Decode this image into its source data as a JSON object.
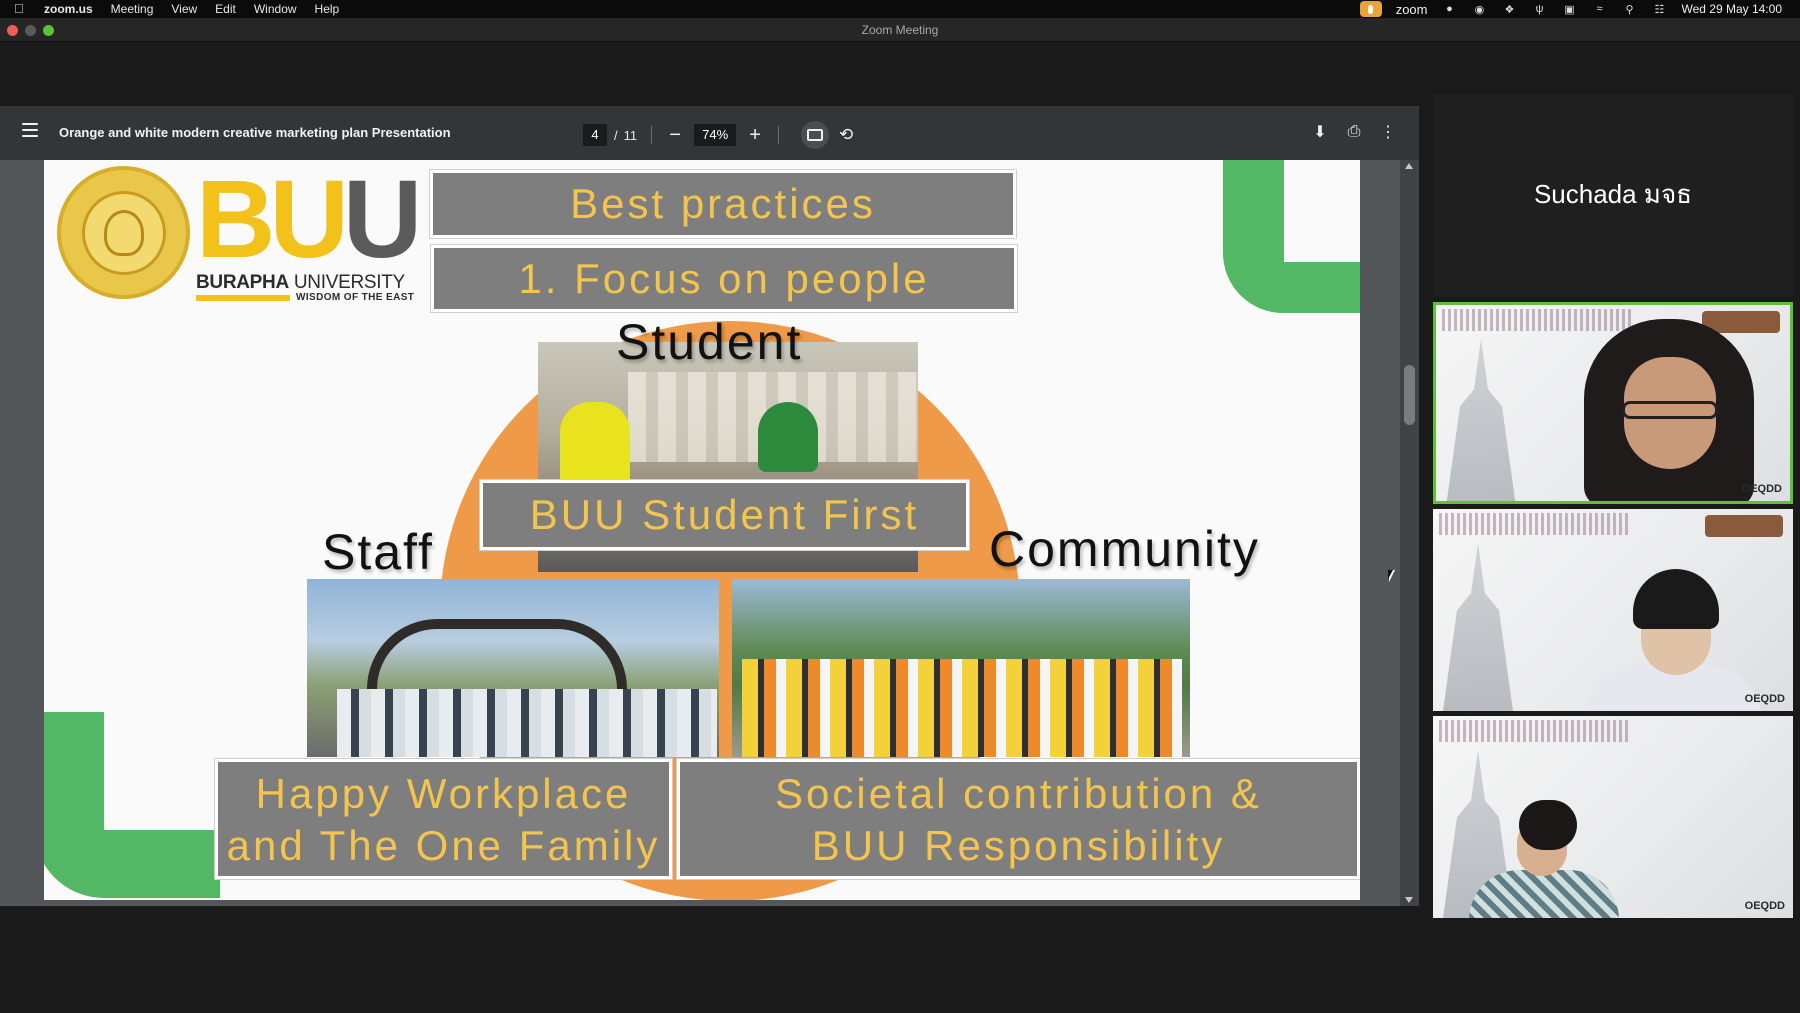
{
  "menubar": {
    "app": "zoom.us",
    "items": [
      "Meeting",
      "View",
      "Edit",
      "Window",
      "Help"
    ],
    "zoom_label": "zoom",
    "clock": "Wed 29 May  14:00"
  },
  "window": {
    "title": "Zoom Meeting"
  },
  "pdf": {
    "title": "Orange and white modern creative marketing plan Presentation",
    "page_current": "4",
    "page_total": "11",
    "zoom": "74%"
  },
  "slide": {
    "title": "Best practices",
    "subtitle": "1. Focus on people",
    "logo_letters": "BUU",
    "logo_name_bold": "BURAPHA",
    "logo_name_rest": " UNIVERSITY",
    "logo_tagline": "WISDOM OF THE EAST",
    "student_label": "Student",
    "staff_label": "Staff",
    "community_label": "Community",
    "student_box": "BUU Student First",
    "staff_box_1": "Happy Workplace",
    "staff_box_2": "and The One Family",
    "community_box_1": "Societal contribution &",
    "community_box_2": "BUU Responsibility"
  },
  "participants": {
    "active_speaker_name": "Suchada มจธ",
    "tiles": [
      {
        "logo": "OEQDD",
        "active": true
      },
      {
        "logo": "OEQDD",
        "active": false
      },
      {
        "logo": "OEQDD",
        "active": false
      }
    ]
  },
  "colors": {
    "accent_green": "#52b865",
    "slide_orange": "#ee9a48",
    "slide_gold_text": "#f3c54e",
    "box_grey": "#7e7e7e"
  }
}
